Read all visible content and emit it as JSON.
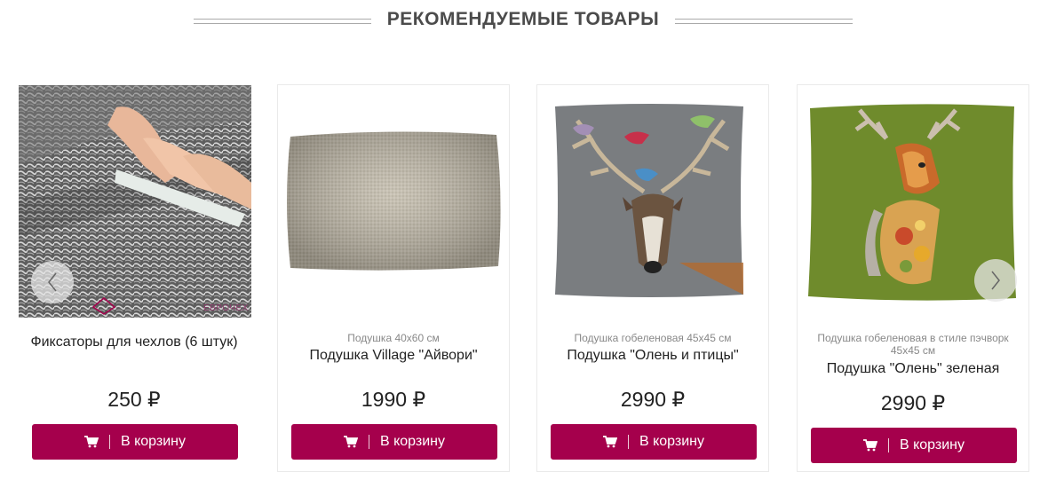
{
  "section": {
    "title": "РЕКОМЕНДУЕМЫЕ ТОВАРЫ"
  },
  "colors": {
    "accent": "#a5004c",
    "title": "#4b4b4b",
    "sub": "#888888"
  },
  "products": [
    {
      "subtitle": "",
      "name": "Фиксаторы для чехлов (6 штук)",
      "price": "250 ₽",
      "button": "В корзину",
      "watermark": "ЕВРОЧЕХ"
    },
    {
      "subtitle": "Подушка 40х60 см",
      "name": "Подушка Village \"Айвори\"",
      "price": "1990 ₽",
      "button": "В корзину"
    },
    {
      "subtitle": "Подушка гобеленовая 45х45 см",
      "name": "Подушка \"Олень и птицы\"",
      "price": "2990 ₽",
      "button": "В корзину"
    },
    {
      "subtitle": "Подушка гобеленовая в стиле пэчворк 45х45 см",
      "name": "Подушка \"Олень\" зеленая",
      "price": "2990 ₽",
      "button": "В корзину"
    }
  ],
  "icons": {
    "cart": "cart-icon",
    "prev": "chevron-left-icon",
    "next": "chevron-right-icon"
  }
}
